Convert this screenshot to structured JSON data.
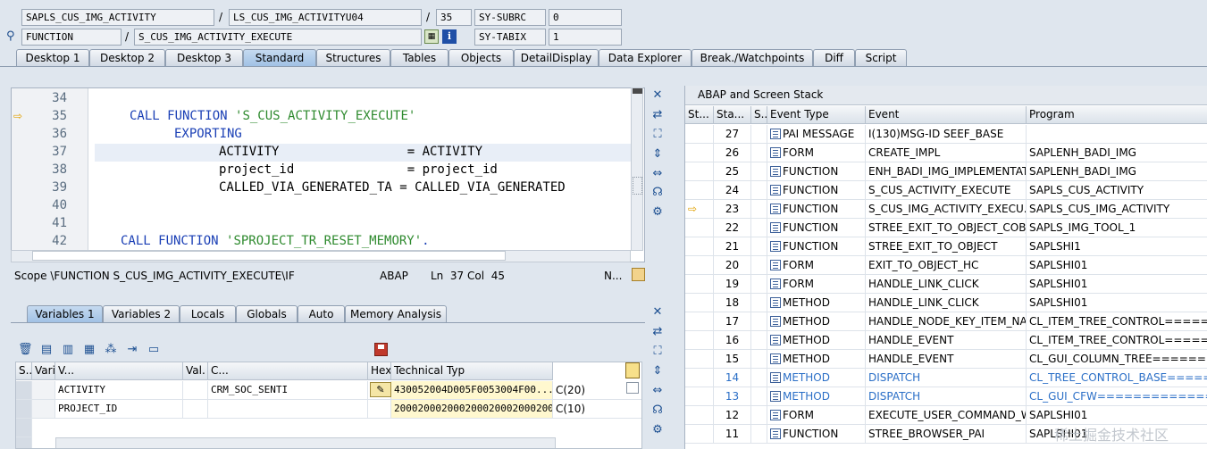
{
  "header": {
    "program": "SAPLS_CUS_IMG_ACTIVITY",
    "include": "LS_CUS_IMG_ACTIVITYU04",
    "line": "35",
    "subrc_label": "SY-SUBRC",
    "subrc_value": "0",
    "event_type": "FUNCTION",
    "event": "S_CUS_IMG_ACTIVITY_EXECUTE",
    "tabix_label": "SY-TABIX",
    "tabix_value": "1",
    "slash": "/"
  },
  "tabs": [
    "Desktop 1",
    "Desktop 2",
    "Desktop 3",
    "Standard",
    "Structures",
    "Tables",
    "Objects",
    "DetailDisplay",
    "Data Explorer",
    "Break./Watchpoints",
    "Diff",
    "Script"
  ],
  "source": {
    "lines": [
      {
        "no": "34",
        "text": ""
      },
      {
        "no": "35",
        "text": "CALL FUNCTION 'S_CUS_ACTIVITY_EXECUTE'"
      },
      {
        "no": "36",
        "text": "EXPORTING"
      },
      {
        "no": "37",
        "text": "ACTIVITY                 = ACTIVITY"
      },
      {
        "no": "38",
        "text": "project_id               = project_id"
      },
      {
        "no": "39",
        "text": "CALLED_VIA_GENERATED_TA = CALLED_VIA_GENERATED"
      },
      {
        "no": "40",
        "text": ""
      },
      {
        "no": "41",
        "text": ""
      },
      {
        "no": "42",
        "text": "CALL FUNCTION 'SPROJECT_TR_RESET_MEMORY'."
      }
    ],
    "scope": "Scope \\FUNCTION S_CUS_IMG_ACTIVITY_EXECUTE\\IF",
    "lang": "ABAP",
    "pos": "Ln  37 Col  45",
    "mode": "N..."
  },
  "vartabs": [
    "Variables 1",
    "Variables 2",
    "Locals",
    "Globals",
    "Auto",
    "Memory Analysis"
  ],
  "vargrid": {
    "headers": [
      "S...",
      "Variable",
      "V...",
      "Val.",
      "C...",
      "Hexadecimal Value",
      "Technical Typ"
    ],
    "rows": [
      {
        "variable": "ACTIVITY",
        "value": "CRM_SOC_SENTI",
        "hex": "430052004D005F0053004F00...",
        "type": "C(20)"
      },
      {
        "variable": "PROJECT_ID",
        "value": "",
        "hex": "2000200020002000200020002000...",
        "type": "C(10)"
      }
    ]
  },
  "stack": {
    "title": "ABAP and Screen Stack",
    "headers": [
      "St...",
      "Sta...",
      "S...",
      "Event Type",
      "Event",
      "Program"
    ],
    "rows": [
      {
        "no": "27",
        "type": "PAI MESSAGE",
        "event": "I(130)MSG-ID SEEF_BASE",
        "program": ""
      },
      {
        "no": "26",
        "type": "FORM",
        "event": "CREATE_IMPL",
        "program": "SAPLENH_BADI_IMG"
      },
      {
        "no": "25",
        "type": "FUNCTION",
        "event": "ENH_BADI_IMG_IMPLEMENTAT...",
        "program": "SAPLENH_BADI_IMG"
      },
      {
        "no": "24",
        "type": "FUNCTION",
        "event": "S_CUS_ACTIVITY_EXECUTE",
        "program": "SAPLS_CUS_ACTIVITY"
      },
      {
        "no": "23",
        "type": "FUNCTION",
        "event": "S_CUS_IMG_ACTIVITY_EXECU...",
        "program": "SAPLS_CUS_IMG_ACTIVITY"
      },
      {
        "no": "22",
        "type": "FUNCTION",
        "event": "STREE_EXIT_TO_OBJECT_COBJ",
        "program": "SAPLS_IMG_TOOL_1"
      },
      {
        "no": "21",
        "type": "FUNCTION",
        "event": "STREE_EXIT_TO_OBJECT",
        "program": "SAPLSHI1"
      },
      {
        "no": "20",
        "type": "FORM",
        "event": "EXIT_TO_OBJECT_HC",
        "program": "SAPLSHI01"
      },
      {
        "no": "19",
        "type": "FORM",
        "event": "HANDLE_LINK_CLICK",
        "program": "SAPLSHI01"
      },
      {
        "no": "18",
        "type": "METHOD",
        "event": "HANDLE_LINK_CLICK",
        "program": "SAPLSHI01"
      },
      {
        "no": "17",
        "type": "METHOD",
        "event": "HANDLE_NODE_KEY_ITEM_NA...",
        "program": "CL_ITEM_TREE_CONTROL========"
      },
      {
        "no": "16",
        "type": "METHOD",
        "event": "HANDLE_EVENT",
        "program": "CL_ITEM_TREE_CONTROL========"
      },
      {
        "no": "15",
        "type": "METHOD",
        "event": "HANDLE_EVENT",
        "program": "CL_GUI_COLUMN_TREE========="
      },
      {
        "no": "14",
        "type": "METHOD",
        "event": "DISPATCH",
        "program": "CL_TREE_CONTROL_BASE========"
      },
      {
        "no": "13",
        "type": "METHOD",
        "event": "DISPATCH",
        "program": "CL_GUI_CFW=================="
      },
      {
        "no": "12",
        "type": "FORM",
        "event": "EXECUTE_USER_COMMAND_W...",
        "program": "SAPLSHI01"
      },
      {
        "no": "11",
        "type": "FUNCTION",
        "event": "STREE_BROWSER_PAI",
        "program": "SAPLSHI01"
      }
    ]
  },
  "watermark": "稀土掘金技术社区"
}
